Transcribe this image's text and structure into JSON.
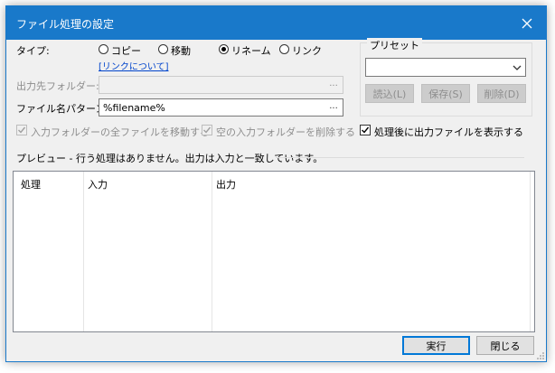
{
  "window": {
    "title": "ファイル処理の設定"
  },
  "type_row": {
    "label": "タイプ:",
    "options": [
      "コピー",
      "移動",
      "リネーム",
      "リンク"
    ],
    "selected": "リネーム",
    "link_help": "[リンクについて]"
  },
  "dest_folder": {
    "label": "出力先フォルダー:",
    "value": "",
    "browse": "..."
  },
  "pattern": {
    "label": "ファイル名パターン:",
    "value": "%filename%",
    "browse": "..."
  },
  "options": {
    "move_all": {
      "label": "入力フォルダーの全ファイルを移動する",
      "checked": true,
      "enabled": false
    },
    "delete_empty": {
      "label": "空の入力フォルダーを削除する",
      "checked": true,
      "enabled": false
    },
    "show_output": {
      "label": "処理後に出力ファイルを表示する",
      "checked": true,
      "enabled": true
    }
  },
  "preset": {
    "title": "プリセット",
    "selected": "",
    "buttons": {
      "load": "読込(L)",
      "save": "保存(S)",
      "delete": "削除(D)"
    }
  },
  "preview": {
    "text": "プレビュー - 行う処理はありません。出力は入力と一致しています。",
    "columns": [
      "処理",
      "入力",
      "出力"
    ]
  },
  "footer": {
    "run": "実行",
    "close": "閉じる"
  },
  "colors": {
    "titlebar": "#1979ca",
    "link": "#0044cc"
  }
}
